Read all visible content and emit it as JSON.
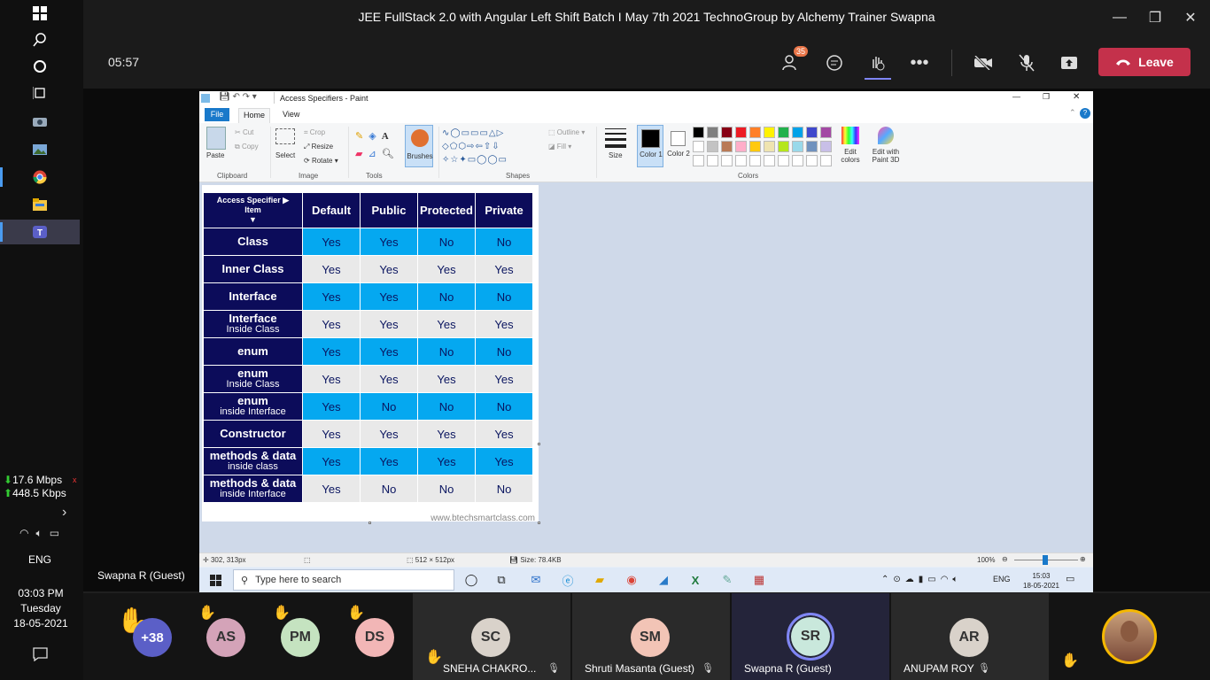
{
  "meeting": {
    "title": "JEE FullStack 2.0 with Angular Left Shift Batch I May 7th 2021 TechnoGroup by Alchemy Trainer Swapna",
    "timer": "05:57",
    "participants_badge": "35",
    "leave_label": "Leave"
  },
  "system": {
    "net_down": "17.6 Mbps",
    "net_up": "448.5 Kbps",
    "lang": "ENG",
    "time": "03:03 PM",
    "day": "Tuesday",
    "date": "18-05-2021"
  },
  "paint": {
    "title": "Access Specifiers - Paint",
    "tabs": [
      "File",
      "Home",
      "View"
    ],
    "clipboard": {
      "paste": "Paste",
      "cut": "Cut",
      "copy": "Copy",
      "group": "Clipboard"
    },
    "image": {
      "select": "Select",
      "crop": "Crop",
      "resize": "Resize",
      "rotate": "Rotate",
      "group": "Image"
    },
    "tools": {
      "brushes": "Brushes",
      "group": "Tools"
    },
    "shapes": {
      "outline": "Outline",
      "fill": "Fill",
      "group": "Shapes"
    },
    "size_label": "Size",
    "color1": "Color 1",
    "color2": "Color 2",
    "colors_group": "Colors",
    "edit_colors": "Edit colors",
    "edit_paint3d": "Edit with Paint 3D",
    "palette_row1": [
      "#000000",
      "#7f7f7f",
      "#880015",
      "#ed1c24",
      "#ff7f27",
      "#fff200",
      "#22b14c",
      "#00a2e8",
      "#3f48cc",
      "#a349a4"
    ],
    "palette_row2": [
      "#ffffff",
      "#c3c3c3",
      "#b97a57",
      "#ffaec9",
      "#ffc90e",
      "#efe4b0",
      "#b5e61d",
      "#99d9ea",
      "#7092be",
      "#c8bfe7"
    ],
    "status": {
      "pos": "302, 313px",
      "dims": "512 × 512px",
      "size": "Size: 78.4KB",
      "zoom": "100%"
    }
  },
  "table": {
    "header_corner": "Access Specifier ▶ Item ▼",
    "header_corner_top": "Access Specifier ▶",
    "header_corner_bottom": "Item",
    "columns": [
      "Default",
      "Public",
      "Protected",
      "Private"
    ],
    "rows": [
      {
        "name": "Class",
        "sub": "",
        "values": [
          "Yes",
          "Yes",
          "No",
          "No"
        ]
      },
      {
        "name": "Inner Class",
        "sub": "",
        "values": [
          "Yes",
          "Yes",
          "Yes",
          "Yes"
        ]
      },
      {
        "name": "Interface",
        "sub": "",
        "values": [
          "Yes",
          "Yes",
          "No",
          "No"
        ]
      },
      {
        "name": "Interface",
        "sub": "Inside Class",
        "values": [
          "Yes",
          "Yes",
          "Yes",
          "Yes"
        ]
      },
      {
        "name": "enum",
        "sub": "",
        "values": [
          "Yes",
          "Yes",
          "No",
          "No"
        ]
      },
      {
        "name": "enum",
        "sub": "Inside Class",
        "values": [
          "Yes",
          "Yes",
          "Yes",
          "Yes"
        ]
      },
      {
        "name": "enum",
        "sub": "inside Interface",
        "values": [
          "Yes",
          "No",
          "No",
          "No"
        ]
      },
      {
        "name": "Constructor",
        "sub": "",
        "values": [
          "Yes",
          "Yes",
          "Yes",
          "Yes"
        ]
      },
      {
        "name": "methods & data",
        "sub": "inside class",
        "values": [
          "Yes",
          "Yes",
          "Yes",
          "Yes"
        ]
      },
      {
        "name": "methods & data",
        "sub": "inside Interface",
        "values": [
          "Yes",
          "No",
          "No",
          "No"
        ]
      }
    ],
    "watermark": "www.btechsmartclass.com"
  },
  "inner_taskbar": {
    "search_placeholder": "Type here to search",
    "lang": "ENG",
    "time": "15:03",
    "date": "18-05-2021"
  },
  "speaker_label": "Swapna R (Guest)",
  "participants": {
    "overflow": "+38",
    "tiles": [
      {
        "initials": "AS",
        "name": ""
      },
      {
        "initials": "PM",
        "name": ""
      },
      {
        "initials": "DS",
        "name": ""
      },
      {
        "initials": "SC",
        "name": "SNEHA CHAKRO..."
      },
      {
        "initials": "SM",
        "name": "Shruti Masanta (Guest)"
      },
      {
        "initials": "SR",
        "name": "Swapna R (Guest)"
      },
      {
        "initials": "AR",
        "name": "ANUPAM ROY"
      }
    ]
  }
}
